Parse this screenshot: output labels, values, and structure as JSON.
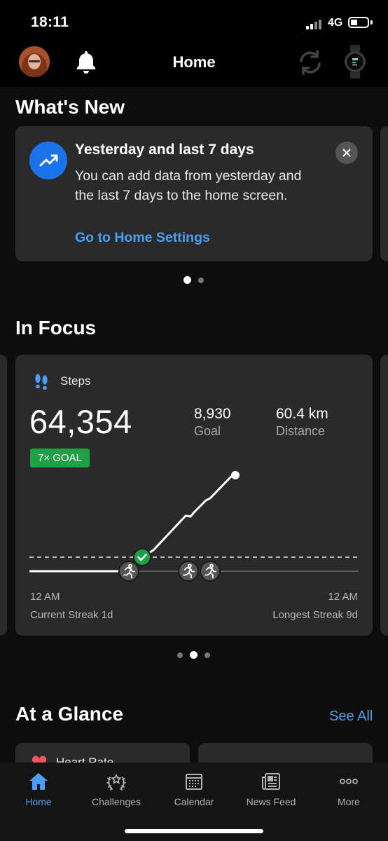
{
  "status_bar": {
    "time": "18:11",
    "network": "4G"
  },
  "header": {
    "title": "Home"
  },
  "whats_new": {
    "title": "What's New",
    "card": {
      "heading": "Yesterday and last 7 days",
      "body": "You can add data from yesterday and the last 7 days to the home screen.",
      "link": "Go to Home Settings"
    },
    "pager": {
      "count": 2,
      "active_index": 0
    }
  },
  "in_focus": {
    "title": "In Focus",
    "steps_card": {
      "label": "Steps",
      "value": "64,354",
      "goal_value": "8,930",
      "goal_label": "Goal",
      "distance_value": "60.4 km",
      "distance_label": "Distance",
      "badge": "7× GOAL",
      "x_start_label": "12 AM",
      "x_end_label": "12 AM",
      "current_streak": "Current Streak 1d",
      "longest_streak": "Longest Streak 9d"
    },
    "pager": {
      "count": 3,
      "active_index": 1
    }
  },
  "at_a_glance": {
    "title": "At a Glance",
    "see_all": "See All",
    "first_card_label": "Heart Rate"
  },
  "tab_bar": {
    "items": [
      {
        "label": "Home",
        "icon": "home-icon",
        "active": true
      },
      {
        "label": "Challenges",
        "icon": "laurel-icon",
        "active": false
      },
      {
        "label": "Calendar",
        "icon": "calendar-icon",
        "active": false
      },
      {
        "label": "News Feed",
        "icon": "newsfeed-icon",
        "active": false
      },
      {
        "label": "More",
        "icon": "more-icon",
        "active": false
      }
    ]
  },
  "colors": {
    "accent": "#4a9ff5",
    "goal_green": "#1fa046",
    "card": "#2a2a2a",
    "background": "#000000"
  }
}
